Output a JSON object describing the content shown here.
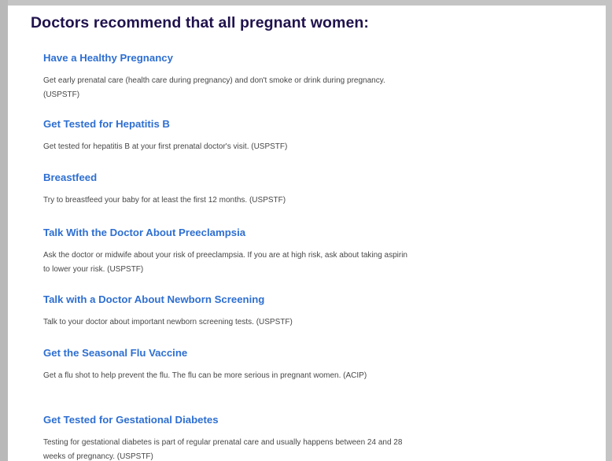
{
  "page": {
    "title": "Doctors recommend that all pregnant women:"
  },
  "items": [
    {
      "heading": "Have a Healthy Pregnancy",
      "text": "Get early prenatal care (health care during pregnancy) and don't smoke or drink during pregnancy. (USPSTF)"
    },
    {
      "heading": "Get Tested for Hepatitis B",
      "text": "Get tested for hepatitis B at your first prenatal doctor's visit. (USPSTF)"
    },
    {
      "heading": "Breastfeed",
      "text": "Try to breastfeed your baby for at least the first 12 months. (USPSTF)"
    },
    {
      "heading": "Talk With the Doctor About Preeclampsia",
      "text": "Ask the doctor or midwife about your risk of preeclampsia. If you are at high risk, ask about taking aspirin to lower your risk. (USPSTF)"
    },
    {
      "heading": "Talk with a Doctor About Newborn Screening",
      "text": "Talk to your doctor about important newborn screening tests. (USPSTF)"
    },
    {
      "heading": "Get the Seasonal Flu Vaccine",
      "text": "Get a flu shot to help prevent the flu. The flu can be more serious in pregnant women. (ACIP)"
    },
    {
      "heading": "Get Tested for Gestational Diabetes",
      "text": "Testing for gestational diabetes is part of regular prenatal care and usually happens between 24 and 28 weeks of pregnancy. (USPSTF)"
    }
  ]
}
